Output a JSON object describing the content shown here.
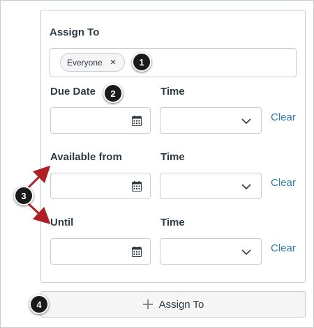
{
  "assign": {
    "label": "Assign To",
    "pill_label": "Everyone",
    "pill_remove_glyph": "×"
  },
  "rows": [
    {
      "label": "Due Date",
      "time_label": "Time",
      "clear": "Clear"
    },
    {
      "label": "Available from",
      "time_label": "Time",
      "clear": "Clear"
    },
    {
      "label": "Until",
      "time_label": "Time",
      "clear": "Clear"
    }
  ],
  "callouts": [
    "1",
    "2",
    "3",
    "4"
  ],
  "add_button": {
    "label": "Assign To"
  },
  "colors": {
    "link": "#2b7abc",
    "arrow": "#b11f24",
    "callout_bg": "#1a1a1a",
    "border": "#c7cdd1"
  },
  "icons": {
    "remove": "close-icon",
    "calendar": "calendar-icon",
    "select": "chevron-down-icon",
    "add": "plus-icon"
  }
}
